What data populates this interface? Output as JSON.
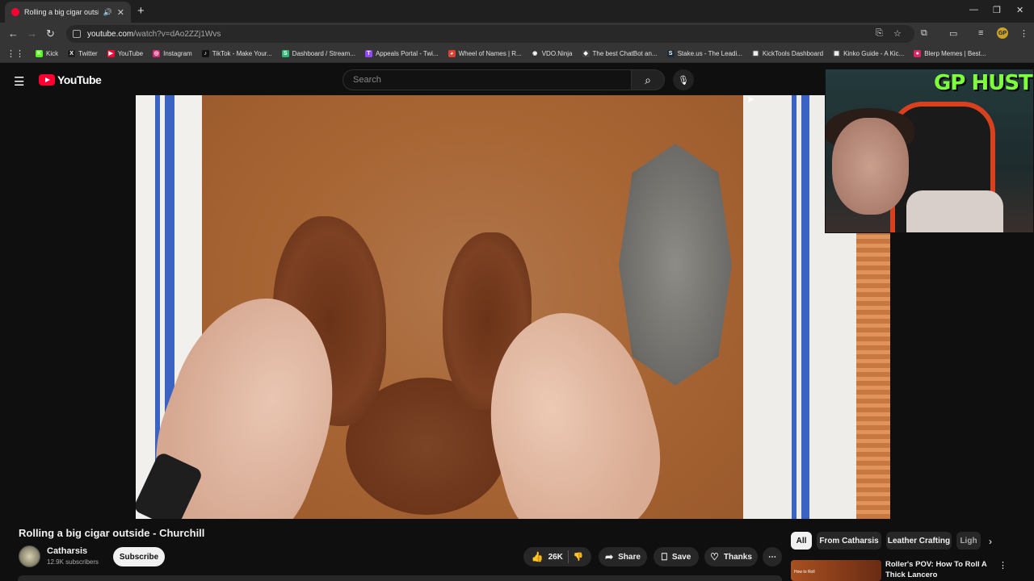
{
  "browser": {
    "tab_title": "Rolling a big cigar outside",
    "url_host": "youtube.com",
    "url_path": "/watch?v=dAo2ZZj1Wvs",
    "bookmarks": [
      {
        "label": "Kick",
        "color": "#53fc18",
        "glyph": "K"
      },
      {
        "label": "Twitter",
        "color": "#1f1f1f",
        "glyph": "X"
      },
      {
        "label": "YouTube",
        "color": "#ff0033",
        "glyph": "▶"
      },
      {
        "label": "Instagram",
        "color": "#d62976",
        "glyph": "◎"
      },
      {
        "label": "TikTok - Make Your...",
        "color": "#111111",
        "glyph": "♪"
      },
      {
        "label": "Dashboard / Stream...",
        "color": "#2fb673",
        "glyph": "S"
      },
      {
        "label": "Appeals Portal - Twi...",
        "color": "#9146ff",
        "glyph": "T"
      },
      {
        "label": "Wheel of Names | R...",
        "color": "#e04030",
        "glyph": "◕"
      },
      {
        "label": "VDO.Ninja",
        "color": "#333333",
        "glyph": "◉"
      },
      {
        "label": "The best ChatBot an...",
        "color": "#444444",
        "glyph": "◆"
      },
      {
        "label": "Stake.us - The Leadi...",
        "color": "#1a2c38",
        "glyph": "S"
      },
      {
        "label": "KickTools Dashboard",
        "color": "#444444",
        "glyph": "▦"
      },
      {
        "label": "Kinko Guide - A Kic...",
        "color": "#444444",
        "glyph": "▦"
      },
      {
        "label": "Blerp Memes | Best...",
        "color": "#e0245e",
        "glyph": "●"
      }
    ]
  },
  "youtube": {
    "logo": "YouTube",
    "search_placeholder": "Search"
  },
  "webcam_overlay_text": "GP HUSTLA",
  "video": {
    "title": "Rolling a big cigar outside - Churchill",
    "channel": "Catharsis",
    "subscribers": "12.9K subscribers",
    "subscribe_label": "Subscribe",
    "likes": "26K",
    "share_label": "Share",
    "save_label": "Save",
    "thanks_label": "Thanks"
  },
  "chips": [
    "All",
    "From Catharsis",
    "Leather Crafting",
    "Ligh"
  ],
  "recommendation": {
    "title": "Roller's POV: How To Roll A Thick Lancero",
    "thumb_text": "How to Roll"
  },
  "colors": {
    "accent_red": "#ff0033",
    "background": "#0f0f0f",
    "overlay_green": "#7dff3a"
  }
}
